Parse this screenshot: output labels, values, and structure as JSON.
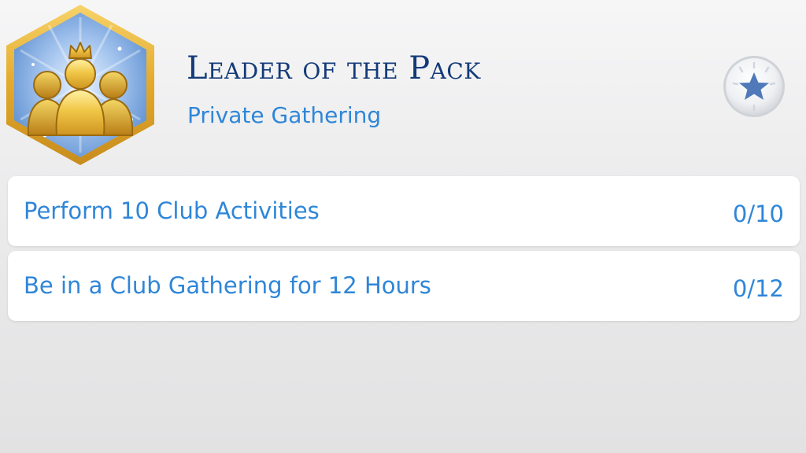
{
  "aspiration": {
    "icon": "club-members-icon",
    "title": "Leader of the Pack",
    "subtitle": "Private Gathering"
  },
  "reward_button": {
    "icon": "star-burst-icon"
  },
  "goals": [
    {
      "label": "Perform 10 Club Activities",
      "progress": "0/10"
    },
    {
      "label": "Be in a Club Gathering for 12 Hours",
      "progress": "0/12"
    }
  ],
  "colors": {
    "title": "#143a78",
    "accent": "#2f86d8",
    "badge_border": "#e8b33a"
  }
}
